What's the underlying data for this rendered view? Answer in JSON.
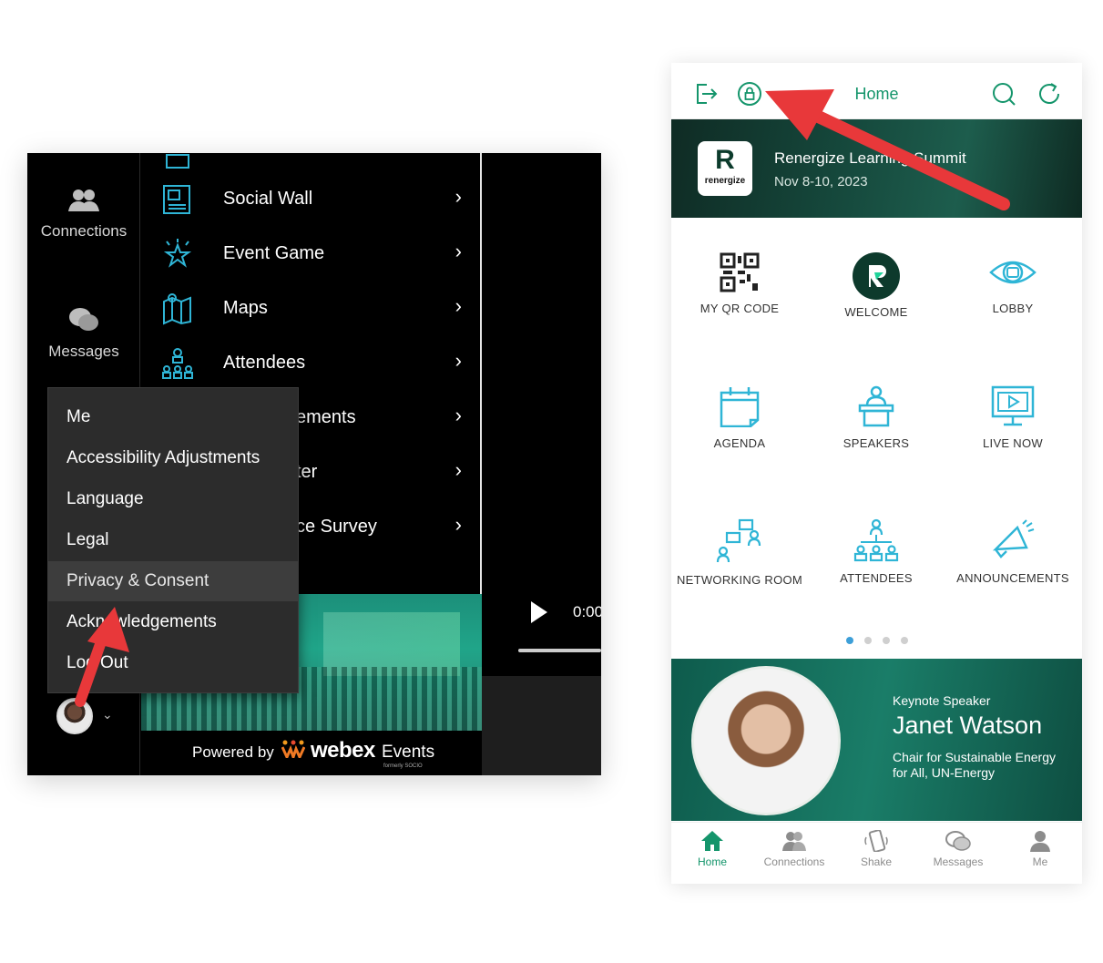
{
  "desktop": {
    "rail": {
      "connections_label": "Connections",
      "messages_label": "Messages"
    },
    "menu": {
      "items": [
        {
          "label": "Social Wall",
          "icon": "social-wall-icon"
        },
        {
          "label": "Event Game",
          "icon": "star-icon"
        },
        {
          "label": "Maps",
          "icon": "map-icon"
        },
        {
          "label": "Attendees",
          "icon": "attendees-icon"
        },
        {
          "label": "ements",
          "icon": "announcements-icon"
        },
        {
          "label": "ter",
          "icon": "twitter-icon"
        },
        {
          "label": "ce Survey",
          "icon": "survey-icon"
        }
      ],
      "chevron": "›"
    },
    "popup": {
      "items": [
        {
          "label": "Me"
        },
        {
          "label": "Accessibility Adjustments"
        },
        {
          "label": "Language"
        },
        {
          "label": "Legal"
        },
        {
          "label": "Privacy & Consent"
        },
        {
          "label": "Acknowledgements"
        },
        {
          "label": "Log Out"
        }
      ],
      "active_index": 4
    },
    "video": {
      "time": "0:00"
    },
    "footer": {
      "powered_by": "Powered by",
      "brand": "webex",
      "brand_suffix": "Events",
      "formerly": "formerly SOCIO"
    },
    "avatar_caret": "⌄"
  },
  "mobile": {
    "topbar": {
      "title": "Home"
    },
    "banner": {
      "logo_letter": "R",
      "logo_text": "renergize",
      "title": "Renergize Learning Summit",
      "date": "Nov 8-10, 2023"
    },
    "tiles": [
      {
        "label": "MY QR CODE",
        "icon": "qr-code-icon"
      },
      {
        "label": "WELCOME",
        "icon": "welcome-logo-icon"
      },
      {
        "label": "LOBBY",
        "icon": "eye-icon"
      },
      {
        "label": "AGENDA",
        "icon": "calendar-icon"
      },
      {
        "label": "SPEAKERS",
        "icon": "speaker-podium-icon"
      },
      {
        "label": "LIVE NOW",
        "icon": "live-monitor-icon"
      },
      {
        "label": "NETWORKING ROOM",
        "icon": "networking-icon"
      },
      {
        "label": "ATTENDEES",
        "icon": "attendees-icon"
      },
      {
        "label": "ANNOUNCEMENTS",
        "icon": "megaphone-icon"
      }
    ],
    "pager": {
      "count": 4,
      "active": 0
    },
    "keynote": {
      "eyebrow": "Keynote Speaker",
      "name": "Janet Watson",
      "caption": "Chair for Sustainable Energy for All, UN-Energy"
    },
    "tabbar": [
      {
        "label": "Home",
        "icon": "home-icon"
      },
      {
        "label": "Connections",
        "icon": "connections-icon"
      },
      {
        "label": "Shake",
        "icon": "shake-icon"
      },
      {
        "label": "Messages",
        "icon": "messages-icon"
      },
      {
        "label": "Me",
        "icon": "person-icon"
      }
    ],
    "active_tab": 0
  },
  "colors": {
    "accent_green": "#14956b",
    "arrow_red": "#e8383a",
    "pager_active": "#3d9fd8"
  }
}
